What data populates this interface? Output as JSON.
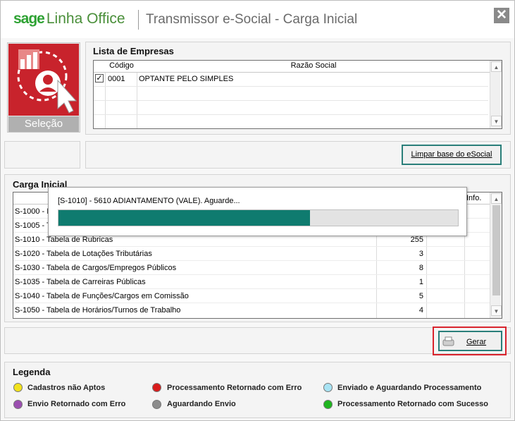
{
  "window": {
    "brand_sage": "sage",
    "brand_product": "Linha Office",
    "title": "Transmissor e-Social - Carga Inicial",
    "close_icon": "close-icon"
  },
  "selection_tile": {
    "caption": "Seleção",
    "icon": "company-selection-icon"
  },
  "empresas": {
    "title": "Lista de Empresas",
    "columns": [
      "Código",
      "Razão Social"
    ],
    "rows": [
      {
        "checked": true,
        "codigo": "0001",
        "razao": "OPTANTE PELO SIMPLES"
      }
    ]
  },
  "limpar_button": "Limpar base do eSocial",
  "carga": {
    "title": "Carga Inicial",
    "info_header": "Info.",
    "rows": [
      {
        "name": "S-1000 - I",
        "count": ""
      },
      {
        "name": "S-1005 - T",
        "count": ""
      },
      {
        "name": "S-1010 - Tabela de Rubricas",
        "count": "255"
      },
      {
        "name": "S-1020 - Tabela de Lotações Tributárias",
        "count": "3"
      },
      {
        "name": "S-1030 - Tabela de Cargos/Empregos Públicos",
        "count": "8"
      },
      {
        "name": "S-1035 - Tabela de Carreiras Públicas",
        "count": "1"
      },
      {
        "name": "S-1040 - Tabela de Funções/Cargos em Comissão",
        "count": "5"
      },
      {
        "name": "S-1050 - Tabela de Horários/Turnos de Trabalho",
        "count": "4"
      }
    ]
  },
  "progress": {
    "message": "[S-1010] - 5610  ADIANTAMENTO (VALE). Aguarde...",
    "fraction": 0.63
  },
  "gerar_button": "Gerar",
  "legend": {
    "title": "Legenda",
    "items": [
      {
        "label": "Cadastros não Aptos",
        "color": "#f2e21c"
      },
      {
        "label": "Processamento Retornado com Erro",
        "color": "#d91c1c"
      },
      {
        "label": "Enviado e Aguardando Processamento",
        "color": "#a8e3f3"
      },
      {
        "label": "Envio Retornado com Erro",
        "color": "#9b4fb0"
      },
      {
        "label": "Aguardando Envio",
        "color": "#8c8c8c"
      },
      {
        "label": "Processamento Retornado com Sucesso",
        "color": "#1fb51f"
      }
    ]
  }
}
